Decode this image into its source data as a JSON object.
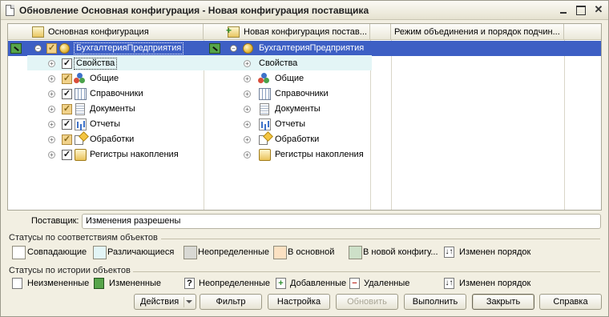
{
  "window": {
    "title": "Обновление Основная конфигурация - Новая конфигурация поставщика"
  },
  "grid": {
    "columns": [
      {
        "label": "Основная конфигурация",
        "icon": "config-icon"
      },
      {
        "label": "Новая конфигурация постав...",
        "icon": "new-config-icon"
      },
      {
        "label": "Режим объединения и порядок подчин...",
        "icon": ""
      }
    ],
    "root": {
      "left_label": "БухгалтерияПредприятия",
      "right_label": "БухгалтерияПредприятия"
    },
    "rows": [
      {
        "left_label": "Свойства",
        "right_label": "Свойства",
        "icon": "properties-icon",
        "checkbox": "checked"
      },
      {
        "left_label": "Общие",
        "right_label": "Общие",
        "icon": "common-icon",
        "checkbox": "partial"
      },
      {
        "left_label": "Справочники",
        "right_label": "Справочники",
        "icon": "catalogs-icon",
        "checkbox": "checked"
      },
      {
        "left_label": "Документы",
        "right_label": "Документы",
        "icon": "documents-icon",
        "checkbox": "partial"
      },
      {
        "left_label": "Отчеты",
        "right_label": "Отчеты",
        "icon": "reports-icon",
        "checkbox": "checked"
      },
      {
        "left_label": "Обработки",
        "right_label": "Обработки",
        "icon": "dataprocessors-icon",
        "checkbox": "partial"
      },
      {
        "left_label": "Регистры накопления",
        "right_label": "Регистры накопления",
        "icon": "accumulation-registers-icon",
        "checkbox": "checked"
      }
    ]
  },
  "supplier": {
    "label": "Поставщик:",
    "value": "Изменения разрешены"
  },
  "match_statuses": {
    "title": "Статусы по соответствиям объектов",
    "items": [
      {
        "label": "Совпадающие",
        "color": "#ffffff"
      },
      {
        "label": "Различающиеся",
        "color": "#e3f5f6"
      },
      {
        "label": "Неопределенные",
        "color": "#d9d9d4"
      },
      {
        "label": "В основной",
        "color": "#fbe1c2"
      },
      {
        "label": "В новой конфигу...",
        "color": "#cde0c8"
      },
      {
        "label": "Изменен порядок",
        "color": ""
      }
    ]
  },
  "history_statuses": {
    "title": "Статусы по истории объектов",
    "items": [
      {
        "label": "Неизмененные"
      },
      {
        "label": "Измененные"
      },
      {
        "label": "Неопределенные",
        "symbol": "?"
      },
      {
        "label": "Добавленные",
        "symbol": "+"
      },
      {
        "label": "Удаленные",
        "symbol": "−"
      },
      {
        "label": "Изменен порядок"
      }
    ]
  },
  "buttons": {
    "actions": "Действия",
    "filter": "Фильтр",
    "settings": "Настройка",
    "refresh": "Обновить",
    "execute": "Выполнить",
    "close": "Закрыть",
    "help": "Справка"
  }
}
